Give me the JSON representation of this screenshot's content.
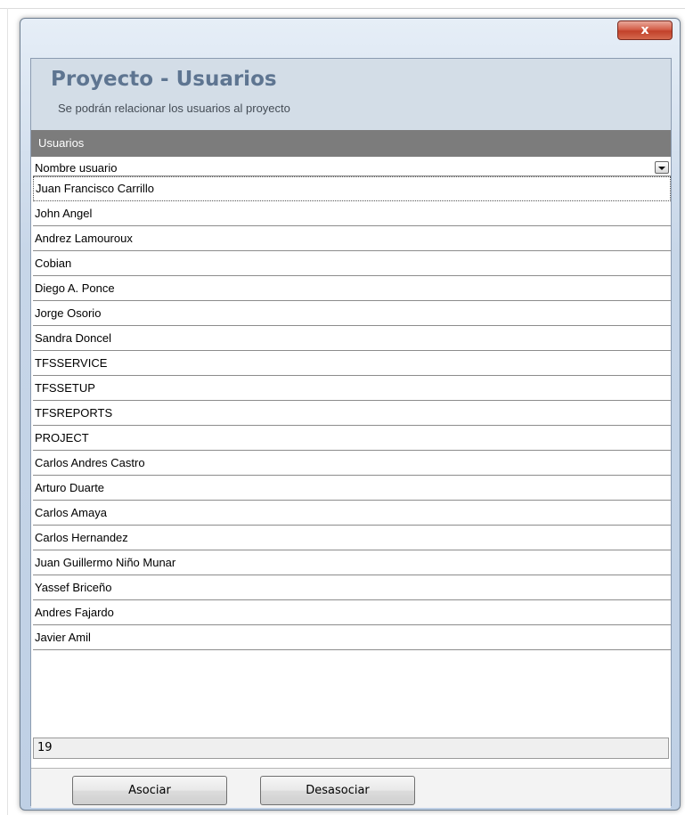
{
  "window": {
    "close_label": "x"
  },
  "header": {
    "title": "Proyecto - Usuarios",
    "subtitle": "Se podrán relacionar los usuarios al proyecto"
  },
  "group": {
    "title": "Usuarios"
  },
  "grid": {
    "column_header": "Nombre usuario",
    "rows": [
      "Juan Francisco Carrillo",
      "John Angel",
      "Andrez Lamouroux",
      "Cobian",
      "Diego A. Ponce",
      "Jorge Osorio",
      "Sandra Doncel",
      "TFSSERVICE",
      "TFSSETUP",
      "TFSREPORTS",
      "PROJECT",
      "Carlos Andres Castro",
      "Arturo Duarte",
      "Carlos Amaya",
      "Carlos Hernandez",
      "Juan Guillermo Niño Munar",
      "Yassef Briceño",
      "Andres Fajardo",
      "Javier Amil"
    ],
    "selected_index": 0,
    "count": "19"
  },
  "buttons": {
    "associate": "Asociar",
    "disassociate": "Desasociar"
  },
  "colors": {
    "title_color": "#5e7591",
    "header_bg": "#d3dde7",
    "group_bar_bg": "#7c7c7c",
    "close_button": "#c2412a"
  }
}
